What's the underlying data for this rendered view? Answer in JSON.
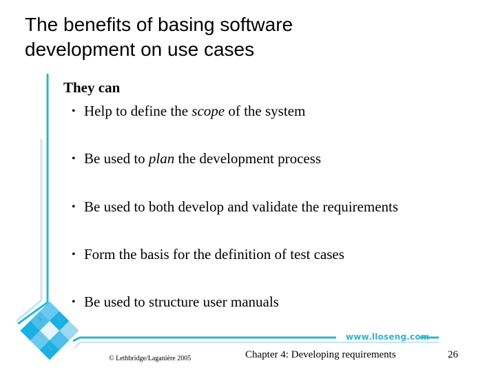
{
  "slide": {
    "title_lines": [
      "The benefits of basing software",
      "development on use cases"
    ],
    "intro": "They can",
    "bullets": [
      {
        "before": "Help to define the ",
        "emphasis": "scope",
        "after": " of the system"
      },
      {
        "before": "Be used to ",
        "emphasis": "plan",
        "after": " the development process"
      },
      {
        "before": "Be used to both develop and validate the requirements",
        "emphasis": "",
        "after": ""
      },
      {
        "before": "Form the basis for the definition of test cases",
        "emphasis": "",
        "after": ""
      },
      {
        "before": "Be used to structure user manuals",
        "emphasis": "",
        "after": ""
      }
    ],
    "bullet_glyph": "•"
  },
  "footer": {
    "copyright": "© Lethbridge/Laganière 2005",
    "chapter": "Chapter 4: Developing requirements",
    "page_number": "26",
    "website": "www.lloseng.com"
  },
  "colors": {
    "accent_dark": "#2db5d0",
    "accent_light": "#c6e6f2",
    "logo_blue": "#1ab0e6",
    "text": "#000000"
  }
}
